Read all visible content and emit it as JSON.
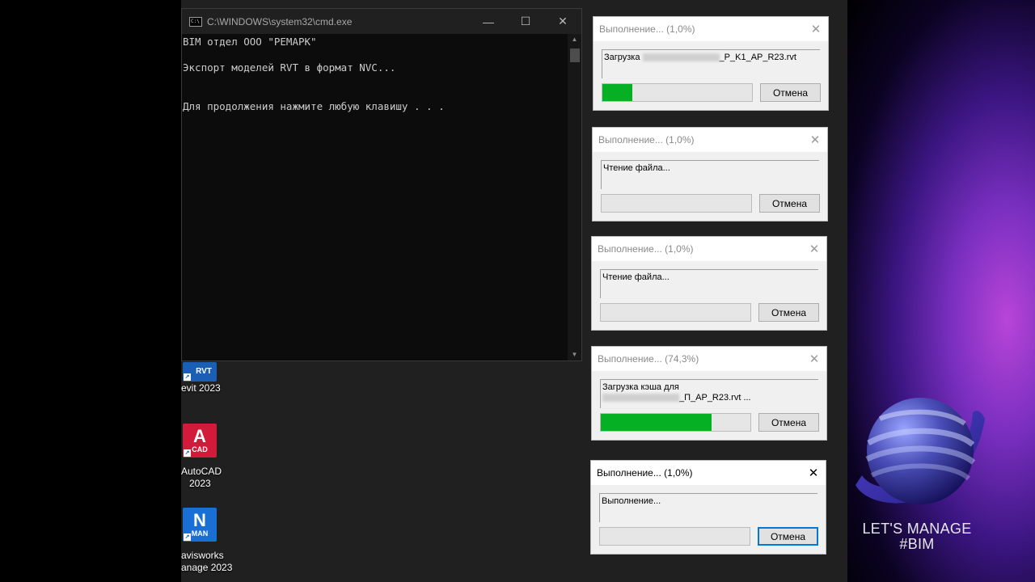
{
  "cmd": {
    "title": "C:\\WINDOWS\\system32\\cmd.exe",
    "lines": [
      "BIM отдел ООО \"РЕМАРК\"",
      "Экспорт моделей RVT в формат NVC...",
      "Для продолжения нажмите любую клавишу . . ."
    ],
    "controls": {
      "minimize": "—",
      "maximize": "☐",
      "close": "✕"
    }
  },
  "desktop": {
    "icons": [
      {
        "letter": "",
        "tag": "RVT",
        "label_lines": [
          "evit 2023"
        ],
        "color": "#1a5fb4"
      },
      {
        "letter": "A",
        "tag": "CAD",
        "label_lines": [
          "AutoCAD",
          "2023"
        ],
        "color": "#d21b3a"
      },
      {
        "letter": "N",
        "tag": "MAN",
        "label_lines": [
          "avisworks",
          "anage 2023"
        ],
        "color": "#1a6fd4"
      }
    ]
  },
  "dialogs": [
    {
      "title": "Выполнение... (1,0%)",
      "message_prefix": "Загрузка",
      "message_line1_suffix": "_P_K1_AP_R23.rvt",
      "message_line2": "",
      "progress": 0.2,
      "cancel": "Отмена",
      "active": false,
      "close": "✕"
    },
    {
      "title": "Выполнение... (1,0%)",
      "message_prefix": "Чтение файла...",
      "message_line1_suffix": "",
      "message_line2": "",
      "progress": 0,
      "cancel": "Отмена",
      "active": false,
      "close": "✕"
    },
    {
      "title": "Выполнение... (1,0%)",
      "message_prefix": "Чтение файла...",
      "message_line1_suffix": "",
      "message_line2": "",
      "progress": 0,
      "cancel": "Отмена",
      "active": false,
      "close": "✕"
    },
    {
      "title": "Выполнение... (74,3%)",
      "message_prefix": "Загрузка кэша для",
      "message_line1_suffix": "",
      "message_line2": "_П_AP_R23.rvt ...",
      "progress": 0.743,
      "cancel": "Отмена",
      "active": false,
      "close": "✕"
    },
    {
      "title": "Выполнение... (1,0%)",
      "message_prefix": "Выполнение...",
      "message_line1_suffix": "",
      "message_line2": "",
      "progress": 0,
      "cancel": "Отмена",
      "active": true,
      "close": "✕"
    }
  ],
  "brand": {
    "line1": "LET'S MANAGE",
    "line2": "#BIM",
    "colors": {
      "accent": "#7a2fc0",
      "globe": "#5a64c8"
    }
  }
}
